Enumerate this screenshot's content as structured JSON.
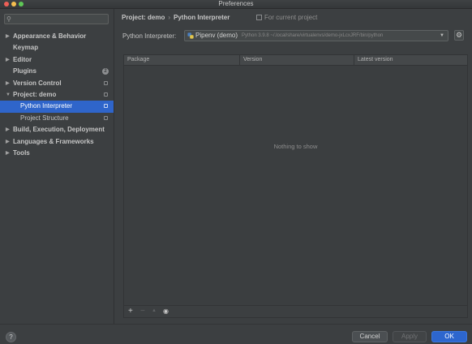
{
  "window": {
    "title": "Preferences"
  },
  "sidebar": {
    "items": [
      {
        "label": "Appearance & Behavior",
        "arrow": "▶",
        "badge": "",
        "icon": false,
        "selected": false,
        "sub": false
      },
      {
        "label": "Keymap",
        "arrow": "",
        "badge": "",
        "icon": false,
        "selected": false,
        "sub": false
      },
      {
        "label": "Editor",
        "arrow": "▶",
        "badge": "",
        "icon": false,
        "selected": false,
        "sub": false
      },
      {
        "label": "Plugins",
        "arrow": "",
        "badge": "2",
        "icon": false,
        "selected": false,
        "sub": false
      },
      {
        "label": "Version Control",
        "arrow": "▶",
        "badge": "",
        "icon": true,
        "selected": false,
        "sub": false
      },
      {
        "label": "Project: demo",
        "arrow": "▼",
        "badge": "",
        "icon": true,
        "selected": false,
        "sub": false
      },
      {
        "label": "Python Interpreter",
        "arrow": "",
        "badge": "",
        "icon": true,
        "selected": true,
        "sub": true
      },
      {
        "label": "Project Structure",
        "arrow": "",
        "badge": "",
        "icon": true,
        "selected": false,
        "sub": true
      },
      {
        "label": "Build, Execution, Deployment",
        "arrow": "▶",
        "badge": "",
        "icon": false,
        "selected": false,
        "sub": false
      },
      {
        "label": "Languages & Frameworks",
        "arrow": "▶",
        "badge": "",
        "icon": false,
        "selected": false,
        "sub": false
      },
      {
        "label": "Tools",
        "arrow": "▶",
        "badge": "",
        "icon": false,
        "selected": false,
        "sub": false
      }
    ]
  },
  "breadcrumb": {
    "project": "Project: demo",
    "separator": "›",
    "page": "Python Interpreter",
    "scope": "For current project"
  },
  "interpreter": {
    "label": "Python Interpreter:",
    "name": "Pipenv (demo)",
    "path": "Python 3.9.8 ~/.local/share/virtualenvs/demo-jxLcxJRF/bin/python"
  },
  "table": {
    "columns": [
      "Package",
      "Version",
      "Latest version"
    ],
    "empty_text": "Nothing to show",
    "toolbar": {
      "add": "+",
      "remove": "−",
      "upgrade": "▲",
      "show": "◉"
    }
  },
  "footer": {
    "help": "?",
    "cancel": "Cancel",
    "apply": "Apply",
    "ok": "OK"
  },
  "colors": {
    "accent": "#2f65ca",
    "background": "#3c3f41"
  }
}
